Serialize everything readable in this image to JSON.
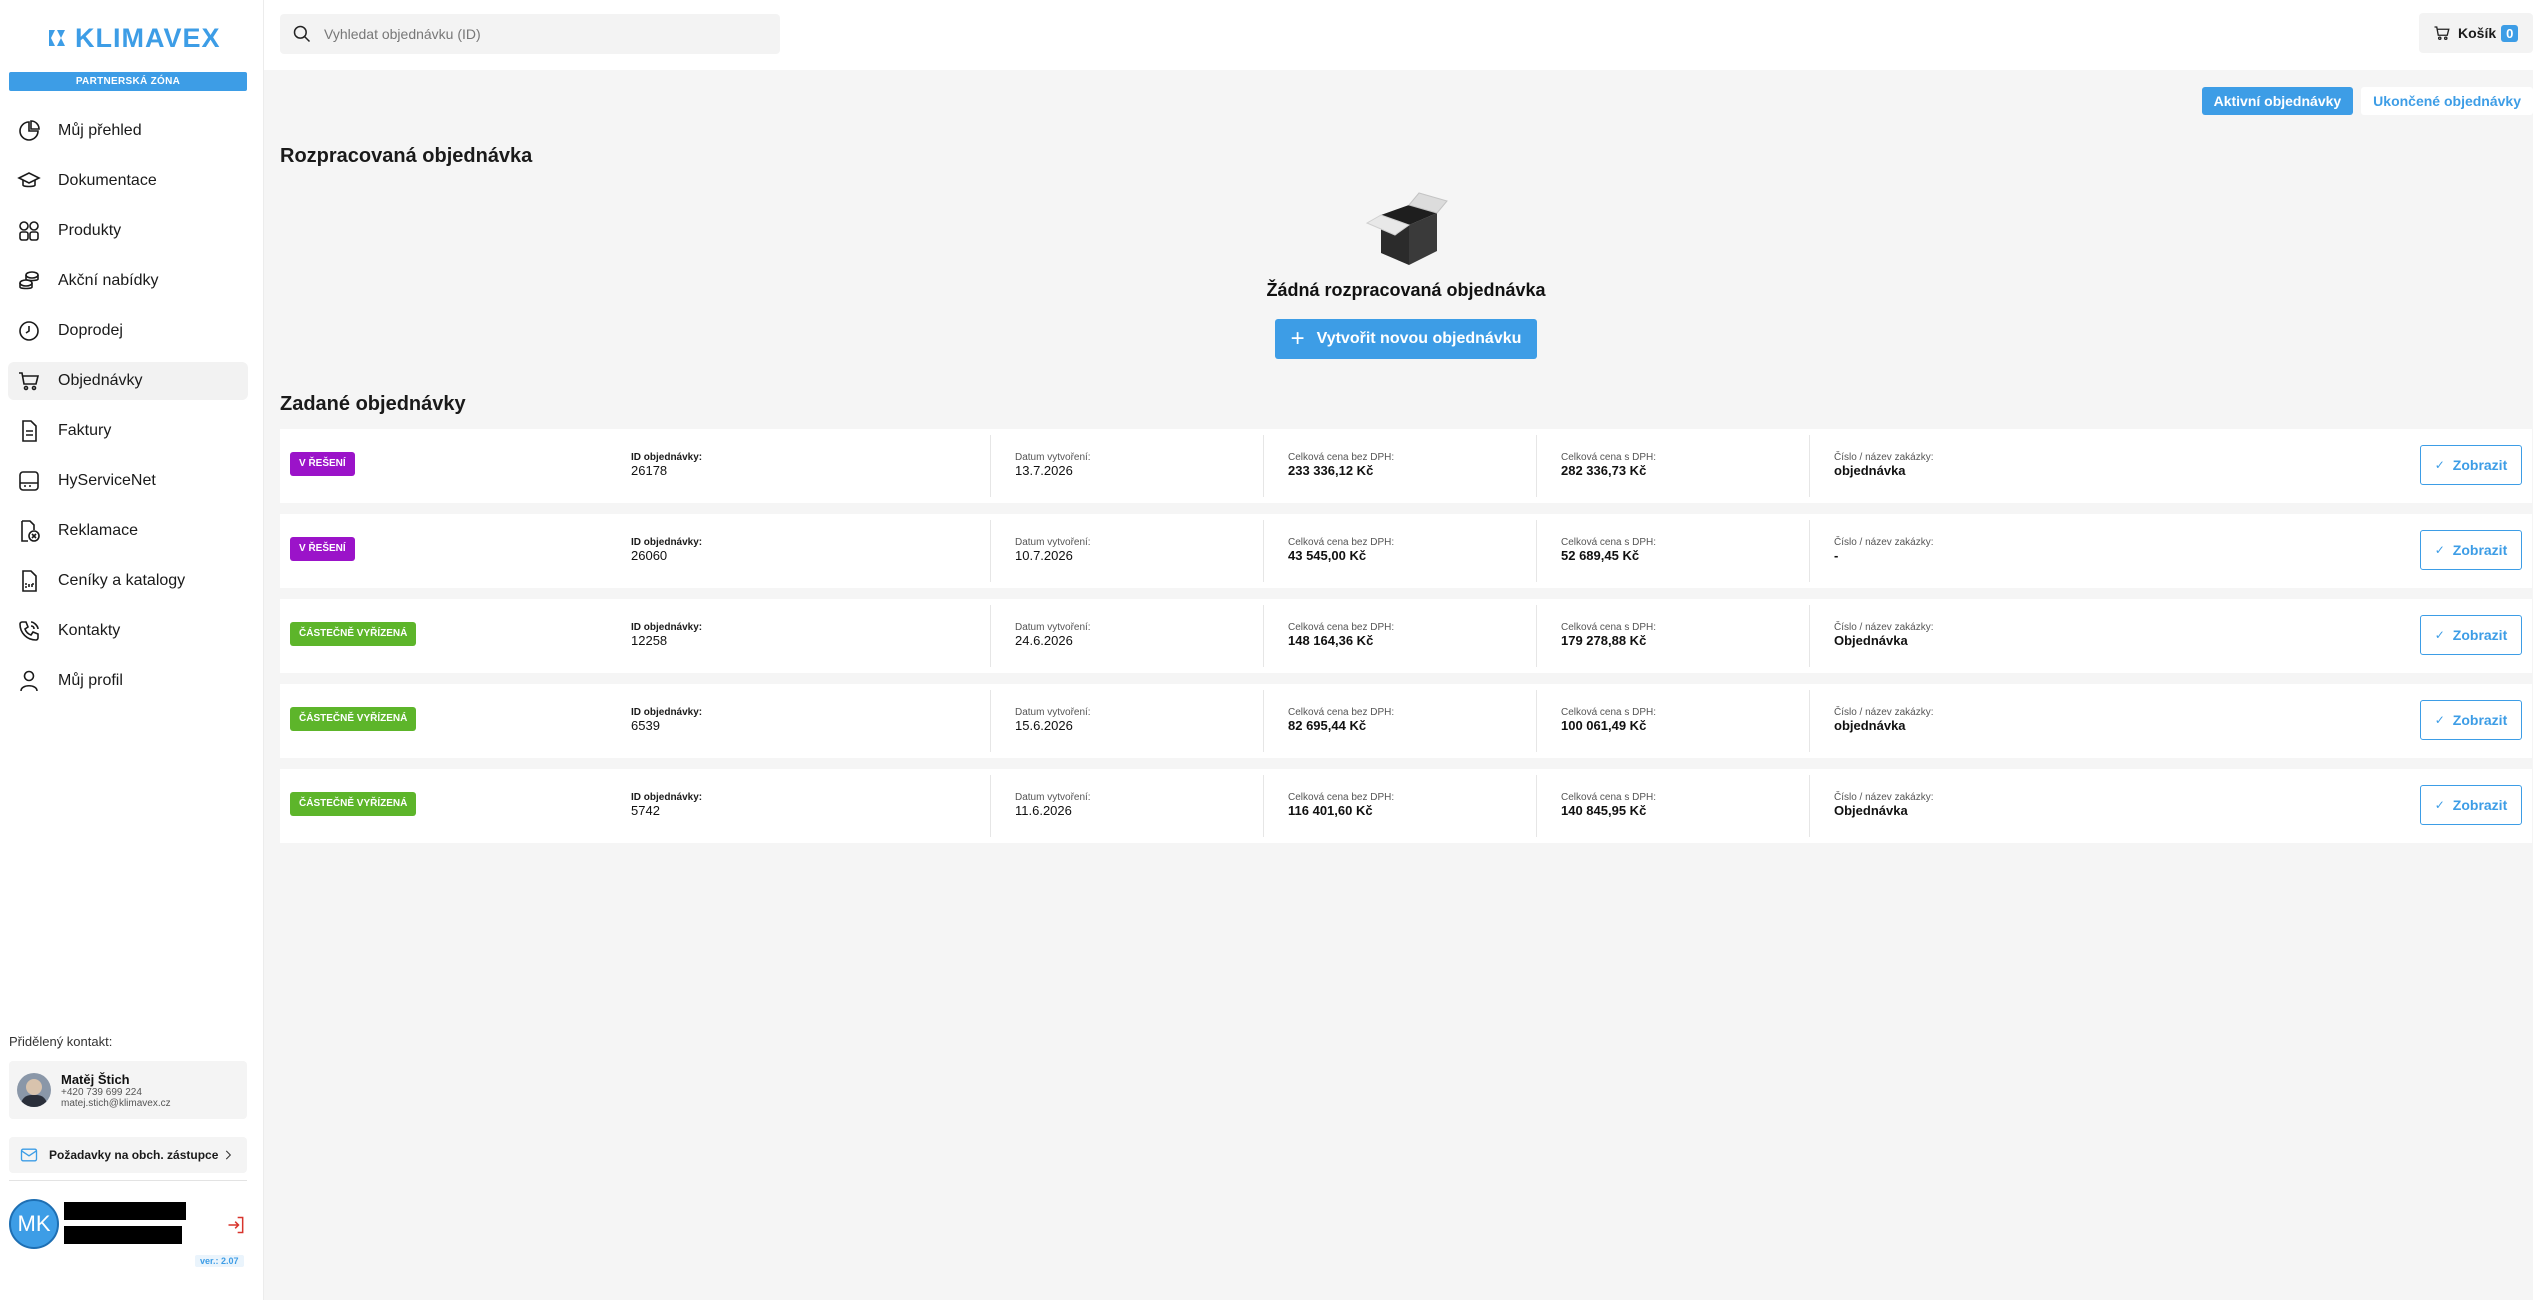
{
  "brand": {
    "name": "KLIMAVEX",
    "zone": "PARTNERSKÁ ZÓNA",
    "accent": "#3d9de6"
  },
  "sidebar": {
    "items": [
      {
        "label": "Můj přehled",
        "icon": "dashboard-pie-icon"
      },
      {
        "label": "Dokumentace",
        "icon": "graduation-cap-icon"
      },
      {
        "label": "Produkty",
        "icon": "grid-icon"
      },
      {
        "label": "Akční nabídky",
        "icon": "coins-icon"
      },
      {
        "label": "Doprodej",
        "icon": "clock-icon"
      },
      {
        "label": "Objednávky",
        "icon": "cart-icon"
      },
      {
        "label": "Faktury",
        "icon": "document-icon"
      },
      {
        "label": "HyServiceNet",
        "icon": "server-icon"
      },
      {
        "label": "Reklamace",
        "icon": "complaint-icon"
      },
      {
        "label": "Ceníky a katalogy",
        "icon": "pdf-icon"
      },
      {
        "label": "Kontakty",
        "icon": "phone-icon"
      },
      {
        "label": "Můj profil",
        "icon": "user-icon"
      }
    ],
    "contact_title": "Přidělený kontakt:",
    "contact": {
      "name": "Matěj Štich",
      "phone": "+420 739 699 224",
      "email": "matej.stich@klimavex.cz"
    },
    "request_link": "Požadavky na obch. zástupce",
    "user_initials": "MK",
    "version": "ver.: 2.07"
  },
  "topbar": {
    "search_placeholder": "Vyhledat objednávku (ID)",
    "cart_label": "Košík",
    "cart_count": "0"
  },
  "tabs": {
    "active": "Aktivní objednávky",
    "finished": "Ukončené objednávky"
  },
  "draft": {
    "title": "Rozpracovaná objednávka",
    "empty_text": "Žádná rozpracovaná objednávka",
    "create_label": "Vytvořit novou objednávku"
  },
  "orders": {
    "title": "Zadané objednávky",
    "labels": {
      "id": "ID objednávky:",
      "date": "Datum vytvoření:",
      "price_no_vat": "Celková cena bez DPH:",
      "price_vat": "Celková cena s DPH:",
      "order_name": "Číslo / název zakázky:"
    },
    "show_label": "Zobrazit",
    "rows": [
      {
        "status": "V ŘEŠENÍ",
        "status_color": "#9b13c9",
        "id": "26178",
        "date": "13.7.2026",
        "price_no_vat": "233 336,12 Kč",
        "price_vat": "282 336,73 Kč",
        "name": "objednávka"
      },
      {
        "status": "V ŘEŠENÍ",
        "status_color": "#9b13c9",
        "id": "26060",
        "date": "10.7.2026",
        "price_no_vat": "43 545,00 Kč",
        "price_vat": "52 689,45 Kč",
        "name": "-"
      },
      {
        "status": "ČÁSTEČNĚ VYŘÍZENÁ",
        "status_color": "#5db52a",
        "id": "12258",
        "date": "24.6.2026",
        "price_no_vat": "148 164,36 Kč",
        "price_vat": "179 278,88 Kč",
        "name": "Objednávka"
      },
      {
        "status": "ČÁSTEČNĚ VYŘÍZENÁ",
        "status_color": "#5db52a",
        "id": "6539",
        "date": "15.6.2026",
        "price_no_vat": "82 695,44 Kč",
        "price_vat": "100 061,49 Kč",
        "name": "objednávka"
      },
      {
        "status": "ČÁSTEČNĚ VYŘÍZENÁ",
        "status_color": "#5db52a",
        "id": "5742",
        "date": "11.6.2026",
        "price_no_vat": "116 401,60 Kč",
        "price_vat": "140 845,95 Kč",
        "name": "Objednávka"
      }
    ]
  }
}
